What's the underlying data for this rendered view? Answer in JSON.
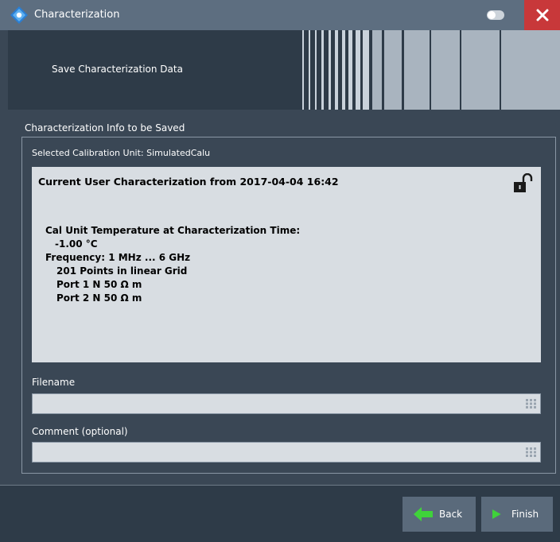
{
  "window": {
    "title": "Characterization",
    "colors": {
      "titlebar": "#5d6e80",
      "header": "#2e3b48",
      "close": "#c8383a",
      "accent": "#3fd23a"
    }
  },
  "header": {
    "title": "Save Characterization Data"
  },
  "section": {
    "label": "Characterization Info to be Saved",
    "cal_unit": "Selected Calibration Unit: SimulatedCalu"
  },
  "info": {
    "heading": "Current User Characterization from 2017-04-04 16:42",
    "lines": [
      "Cal Unit Temperature at Characterization Time:",
      "-1.00 °C",
      "Frequency: 1 MHz ... 6 GHz",
      "201 Points in linear Grid",
      "Port 1 N 50 Ω m",
      "Port 2 N 50 Ω m"
    ]
  },
  "fields": {
    "filename": {
      "label": "Filename",
      "value": ""
    },
    "comment": {
      "label": "Comment (optional)",
      "value": ""
    }
  },
  "buttons": {
    "back": "Back",
    "finish": "Finish"
  },
  "icons": [
    "rs-logo-icon",
    "pin-toggle-icon",
    "close-icon",
    "unlock-icon",
    "keyboard-icon",
    "arrow-left-icon",
    "arrow-right-icon"
  ]
}
